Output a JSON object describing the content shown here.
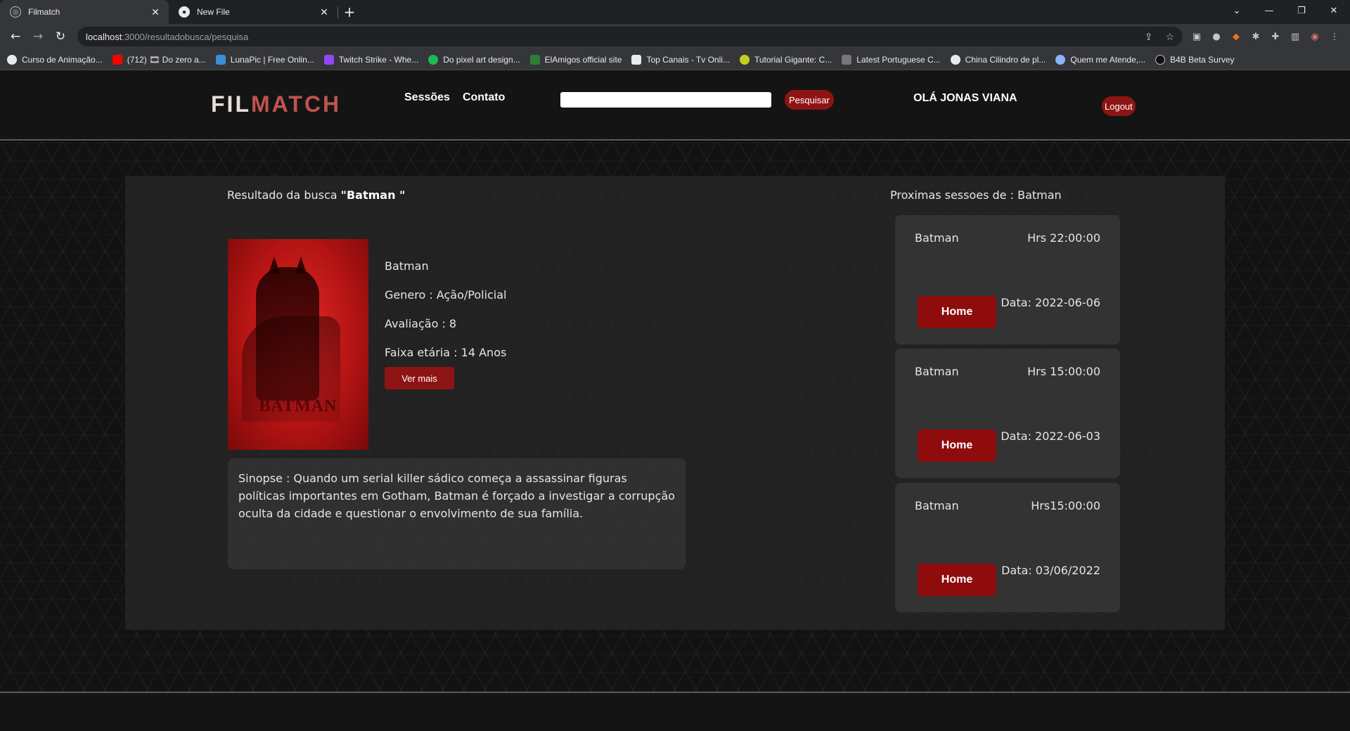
{
  "browser": {
    "tabs": [
      {
        "title": "Filmatch",
        "active": true
      },
      {
        "title": "New File",
        "active": false
      }
    ],
    "url_host": "localhost",
    "url_path": ":3000/resultadobusca/pesquisa",
    "bookmarks": [
      "Curso de Animação...",
      "(712) 🎞 Do zero a...",
      "LunaPic | Free Onlin...",
      "Twitch Strike - Whe...",
      "Do pixel art design...",
      "ElAmigos official site",
      "Top Canais - Tv Onli...",
      "Tutorial Gigante: C...",
      "Latest Portuguese C...",
      "China Cilindro de pl...",
      "Quem me Atende,...",
      "B4B Beta Survey"
    ]
  },
  "header": {
    "logo_a": "FIL",
    "logo_b": "MATCH",
    "nav": [
      "Sessões",
      "Contato"
    ],
    "search_button": "Pesquisar",
    "greeting": "OLÁ JONAS VIANA",
    "logout": "Logout"
  },
  "result": {
    "prefix": "Resultado da busca ",
    "query": "\"Batman \"",
    "poster_title": "BATMAN",
    "title": "Batman",
    "genre": "Genero : Ação/Policial",
    "rating": "Avaliação : 8",
    "age": "Faixa etária : 14 Anos",
    "more_button": "Ver mais",
    "synopsis": "Sinopse : Quando um serial killer sádico começa a assassinar figuras políticas importantes em Gotham, Batman é forçado a investigar a corrupção oculta da cidade e questionar o envolvimento de sua família."
  },
  "sessions": {
    "title": "Proximas sessoes de : Batman",
    "items": [
      {
        "name": "Batman",
        "hrs": "Hrs 22:00:00",
        "date": "Data: 2022-06-06",
        "button": "Home"
      },
      {
        "name": "Batman",
        "hrs": "Hrs 15:00:00",
        "date": "Data: 2022-06-03",
        "button": "Home"
      },
      {
        "name": "Batman",
        "hrs": "Hrs15:00:00",
        "date": "Data: 03/06/2022",
        "button": "Home"
      }
    ]
  }
}
